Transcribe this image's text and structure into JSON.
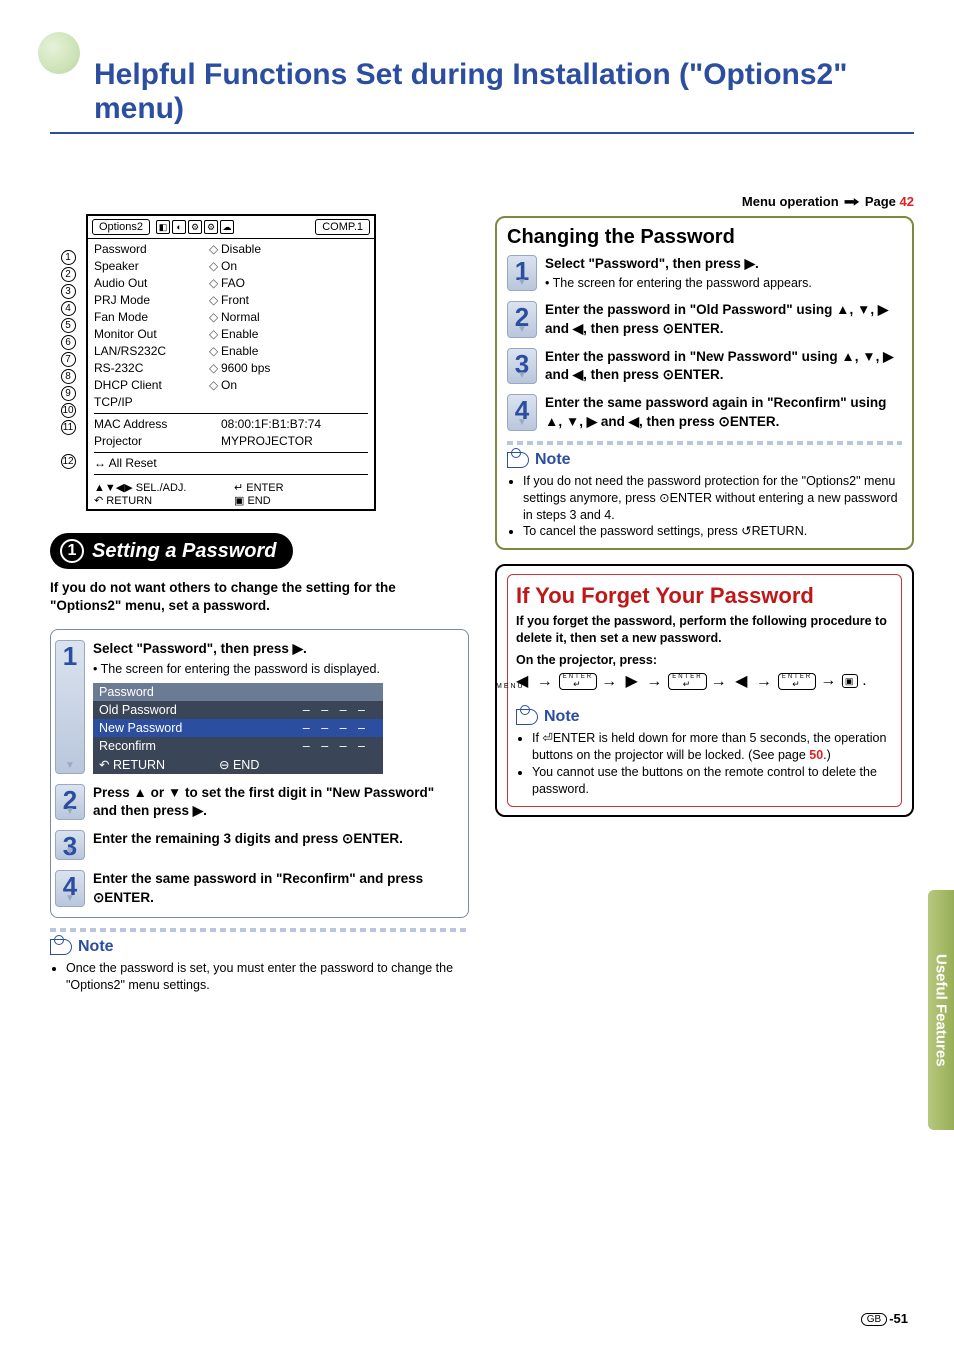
{
  "page": {
    "title": "Helpful Functions Set during Installation (\"Options2\" menu)",
    "menu_op_label": "Menu operation",
    "menu_op_page_word": "Page",
    "menu_op_page": "42",
    "side_tab": "Useful Features",
    "footer_region": "GB",
    "footer_page": "-51"
  },
  "osd": {
    "tab": "Options2",
    "input": "COMP.1",
    "rows": [
      {
        "n": "1",
        "k": "Password",
        "v": "Disable"
      },
      {
        "n": "2",
        "k": "Speaker",
        "v": "On"
      },
      {
        "n": "3",
        "k": "Audio Out",
        "v": "FAO"
      },
      {
        "n": "4",
        "k": "PRJ Mode",
        "v": "Front"
      },
      {
        "n": "5",
        "k": "Fan Mode",
        "v": "Normal"
      },
      {
        "n": "6",
        "k": "Monitor Out",
        "v": "Enable"
      },
      {
        "n": "7",
        "k": "LAN/RS232C",
        "v": "Enable"
      },
      {
        "n": "8",
        "k": "RS-232C",
        "v": "9600 bps"
      },
      {
        "n": "9",
        "k": "DHCP Client",
        "v": "On"
      },
      {
        "n": "10",
        "k": "TCP/IP",
        "v": ""
      },
      {
        "n": "11",
        "k": "MAC Address",
        "v": "08:00:1F:B1:B7:74"
      },
      {
        "n": "",
        "k": "Projector",
        "v": "MYPROJECTOR"
      },
      {
        "n": "12",
        "k": "All Reset",
        "v": "",
        "pre": "↔"
      }
    ],
    "foot": {
      "sel": "SEL./ADJ.",
      "enter": "ENTER",
      "return": "RETURN",
      "end": "END"
    }
  },
  "left": {
    "pill_num": "1",
    "pill_title": "Setting a Password",
    "intro": "If you do not want others to change the setting for the \"Options2\" menu, set a password.",
    "steps": [
      {
        "n": "1",
        "hd": "Select \"Password\", then press ▶.",
        "sub": "• The screen for entering the password is displayed."
      },
      {
        "n": "2",
        "hd": "Press ▲ or ▼ to set the first digit in \"New Password\" and then press ▶."
      },
      {
        "n": "3",
        "hd": "Enter the remaining 3 digits and press ⊙ENTER."
      },
      {
        "n": "4",
        "hd": "Enter the same password in \"Reconfirm\" and press ⊙ENTER."
      }
    ],
    "pw_osd": {
      "title": "Password",
      "rows": [
        {
          "k": "Old Password",
          "dash": "– – – –"
        },
        {
          "k": "New Password",
          "dash": "– – – –",
          "sel": true
        },
        {
          "k": "Reconfirm",
          "dash": "– – – –"
        }
      ],
      "return": "RETURN",
      "end": "END"
    },
    "note_label": "Note",
    "note_items": [
      "Once the password is set, you must enter the password to change the \"Options2\" menu settings."
    ]
  },
  "right": {
    "changing": {
      "title": "Changing the Password",
      "steps": [
        {
          "n": "1",
          "hd": "Select \"Password\", then press ▶.",
          "sub": "• The screen for entering the password appears."
        },
        {
          "n": "2",
          "hd": "Enter the password in \"Old Password\" using ▲, ▼, ▶ and ◀, then press ⊙ENTER."
        },
        {
          "n": "3",
          "hd": "Enter the password in \"New Password\" using ▲, ▼, ▶ and ◀, then press ⊙ENTER."
        },
        {
          "n": "4",
          "hd": "Enter the same password again in \"Reconfirm\" using ▲, ▼, ▶ and ◀, then press ⊙ENTER."
        }
      ],
      "note_label": "Note",
      "note_items": [
        "If you do not need the password protection for the \"Options2\" menu settings anymore, press ⊙ENTER without entering a new password in steps 3 and 4.",
        "To cancel the password settings, press ↺RETURN."
      ]
    },
    "forget": {
      "title": "If You Forget Your Password",
      "intro": "If you forget the password, perform the following procedure to delete it, then set a new password.",
      "on_proj": "On the projector, press:",
      "seq_end": ".",
      "note_label": "Note",
      "note_items": [
        "If ⏎ENTER is held down for more than 5 seconds, the operation buttons on the projector will be locked. (See page ",
        "50",
        ".)",
        "You cannot use the buttons on the remote control to delete the password."
      ]
    }
  }
}
